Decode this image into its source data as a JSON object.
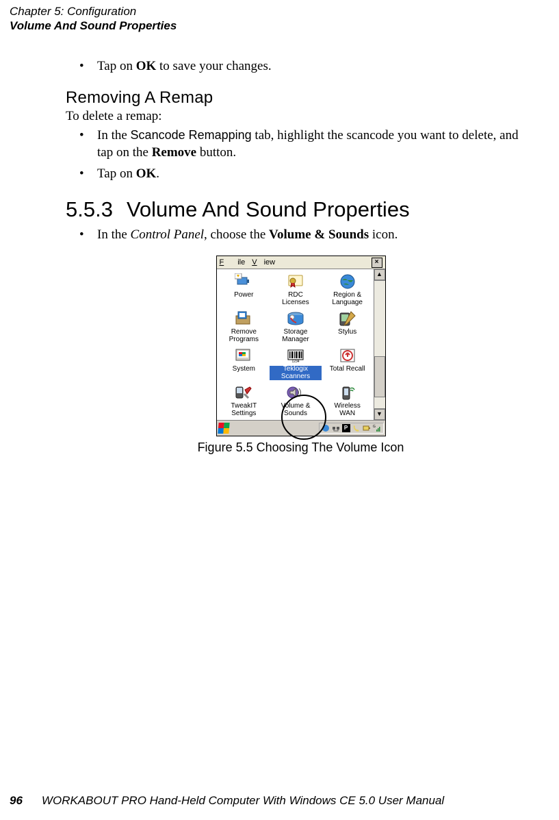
{
  "header": {
    "chapter_line": "Chapter 5: Configuration",
    "section_line": "Volume And Sound Properties"
  },
  "body": {
    "bullet_save": {
      "pre": "Tap on ",
      "bold": "OK",
      "post": " to save your changes."
    },
    "sub_heading": "Removing A Remap",
    "sub_intro": "To delete a remap:",
    "bullet_remove": {
      "pre": "In the ",
      "sansbold": "Scancode Remapping",
      "mid": " tab, highlight the scancode you want to delete, and tap on the ",
      "bold": "Remove",
      "post": " button."
    },
    "bullet_ok": {
      "pre": "Tap on ",
      "bold": "OK",
      "post": "."
    },
    "section_num": "5.5.3",
    "section_title": "Volume And Sound Properties",
    "bullet_cp": {
      "pre": "In the ",
      "italic": "Control Panel",
      "mid": ", choose the ",
      "bold": "Volume & Sounds",
      "post": " icon."
    },
    "figure_caption": "Figure 5.5 Choosing The Volume Icon"
  },
  "screenshot": {
    "menu": {
      "file": "File",
      "view": "View",
      "close": "×"
    },
    "icons": [
      {
        "label": "Power"
      },
      {
        "label": "RDC\nLicenses"
      },
      {
        "label": "Region &\nLanguage"
      },
      {
        "label": "Remove\nPrograms"
      },
      {
        "label": "Storage\nManager"
      },
      {
        "label": "Stylus"
      },
      {
        "label": "System"
      },
      {
        "label": "Teklogix\nScanners",
        "selected": true
      },
      {
        "label": "Total Recall"
      },
      {
        "label": "TweakIT\nSettings"
      },
      {
        "label": "Volume &\nSounds",
        "circled": true
      },
      {
        "label": "Wireless\nWAN"
      }
    ],
    "scroll": {
      "up": "▲",
      "down": "▼"
    },
    "taskbar": {
      "tray_p": "P"
    }
  },
  "footer": {
    "page_num": "96",
    "text": "WORKABOUT PRO Hand-Held Computer With Windows CE 5.0 User Manual"
  }
}
